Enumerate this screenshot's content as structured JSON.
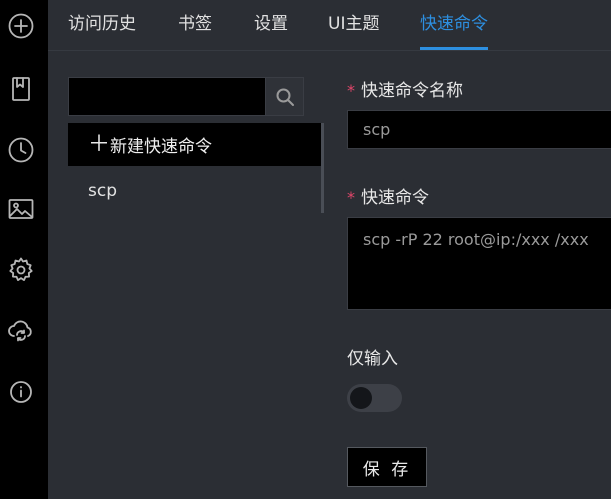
{
  "rail": {
    "icons": [
      "add-circle-icon",
      "bookmark-icon",
      "history-clock-icon",
      "image-icon",
      "settings-gear-icon",
      "cloud-sync-icon",
      "info-icon"
    ]
  },
  "tabs": [
    {
      "label": "访问历史",
      "active": false
    },
    {
      "label": "书签",
      "active": false
    },
    {
      "label": "设置",
      "active": false
    },
    {
      "label": "UI主题",
      "active": false
    },
    {
      "label": "快速命令",
      "active": true
    }
  ],
  "search": {
    "value": "",
    "placeholder": "",
    "icon": "search-icon"
  },
  "list": {
    "new_label": "新建快速命令",
    "new_icon": "＋",
    "items": [
      "scp"
    ]
  },
  "form": {
    "required_mark": "*",
    "name_label": "快速命令名称",
    "name_value": "scp",
    "command_label": "快速命令",
    "command_value": "scp -rP 22 root@ip:/xxx /xxx",
    "input_only_label": "仅输入",
    "input_only_on": false,
    "save_label": "保 存"
  },
  "colors": {
    "accent": "#2d8fe0",
    "required": "#e0466a",
    "background": "#2b2e34",
    "rail": "#000000"
  }
}
